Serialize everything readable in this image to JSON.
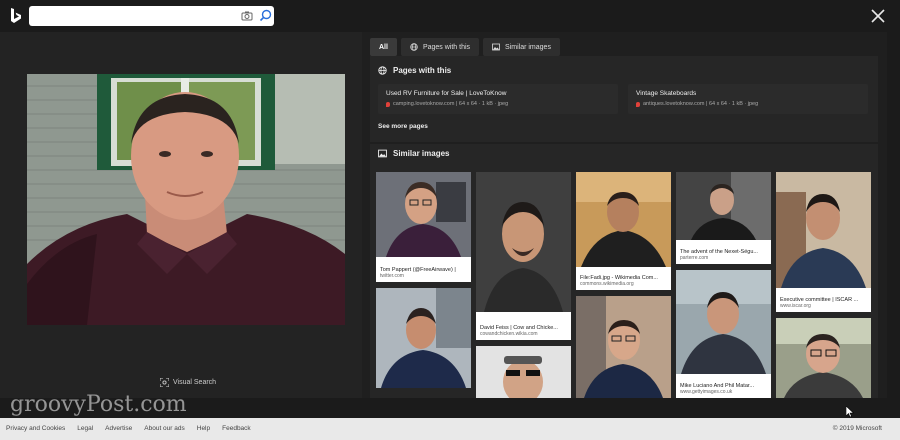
{
  "header": {
    "search_placeholder": "",
    "search_value": ""
  },
  "viewer": {
    "visual_search_label": "Visual Search"
  },
  "tabs": [
    {
      "label": "All",
      "active": true
    },
    {
      "label": "Pages with this",
      "icon": "globe-icon"
    },
    {
      "label": "Similar images",
      "icon": "image-icon"
    }
  ],
  "pages_with_this": {
    "heading": "Pages with this",
    "items": [
      {
        "title": "Used RV Furniture for Sale | LoveToKnow",
        "meta": "camping.lovetoknow.com | 64 x 64 · 1 kB · jpeg"
      },
      {
        "title": "Vintage Skateboards",
        "meta": "antiques.lovetoknow.com | 64 x 64 · 1 kB · jpeg"
      }
    ],
    "see_more": "See more pages"
  },
  "similar_images": {
    "heading": "Similar images",
    "captions": [
      {
        "title": "Tom Pappert (@FreeAirwave) |",
        "source": "twitter.com"
      },
      {
        "title": "David Feiss | Cow and Chicke...",
        "source": "cowandchicken.wikia.com"
      },
      {
        "title": "File:Fadi.jpg - Wikimedia Com...",
        "source": "commons.wikimedia.org"
      },
      {
        "title": "The advent of the Nexet-Ségu...",
        "source": "parterre.com"
      },
      {
        "title": "Executive committee | ISCAR ...",
        "source": "www.iscar.org"
      },
      {
        "title": "Mike Luciano And Phil Matar...",
        "source": "www.gettyimages.co.uk"
      }
    ]
  },
  "watermark": "groovyPost.com",
  "footer": {
    "links": [
      "Privacy and Cookies",
      "Legal",
      "Advertise",
      "About our ads",
      "Help",
      "Feedback"
    ],
    "copyright": "© 2019 Microsoft"
  },
  "colors": {
    "background": "#1b1b1b",
    "panel": "#1f1f1f",
    "card": "#2b2b2b",
    "footer": "#e9e9e9"
  }
}
